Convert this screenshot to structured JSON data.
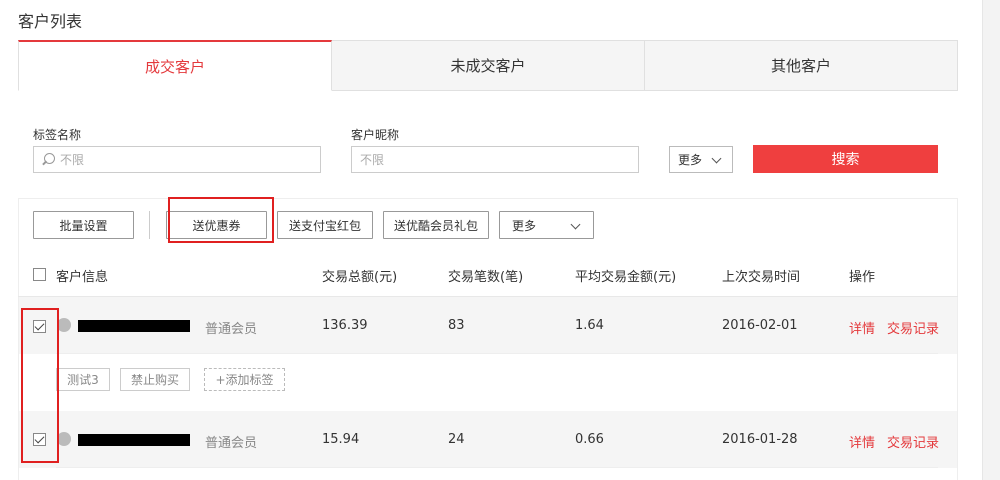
{
  "page": {
    "title": "客户列表"
  },
  "tabs": [
    {
      "label": "成交客户",
      "active": true
    },
    {
      "label": "未成交客户",
      "active": false
    },
    {
      "label": "其他客户",
      "active": false
    }
  ],
  "filters": {
    "tag_label": "标签名称",
    "tag_placeholder": "不限",
    "nickname_label": "客户昵称",
    "nickname_placeholder": "不限",
    "more_label": "更多",
    "search_label": "搜索"
  },
  "toolbar": {
    "batch_settings": "批量设置",
    "send_coupon": "送优惠券",
    "send_alipay_redpack": "送支付宝红包",
    "send_member_gift": "送优酷会员礼包",
    "more": "更多"
  },
  "table": {
    "headers": [
      "客户信息",
      "交易总额(元)",
      "交易笔数(笔)",
      "平均交易金额(元)",
      "上次交易时间",
      "操作"
    ],
    "rows": [
      {
        "checked": true,
        "level": "普通会员",
        "total": "136.39",
        "count": "83",
        "avg": "1.64",
        "last_date": "2016-02-01",
        "action_detail": "详情",
        "action_records": "交易记录",
        "tags": [
          "测试3",
          "禁止购买"
        ],
        "add_tag": "+添加标签"
      },
      {
        "checked": true,
        "level": "普通会员",
        "total": "15.94",
        "count": "24",
        "avg": "0.66",
        "last_date": "2016-01-28",
        "action_detail": "详情",
        "action_records": "交易记录"
      }
    ]
  },
  "colors": {
    "accent": "#e4393c",
    "search_button": "#ef3f3f",
    "annotation": "#e02020"
  }
}
